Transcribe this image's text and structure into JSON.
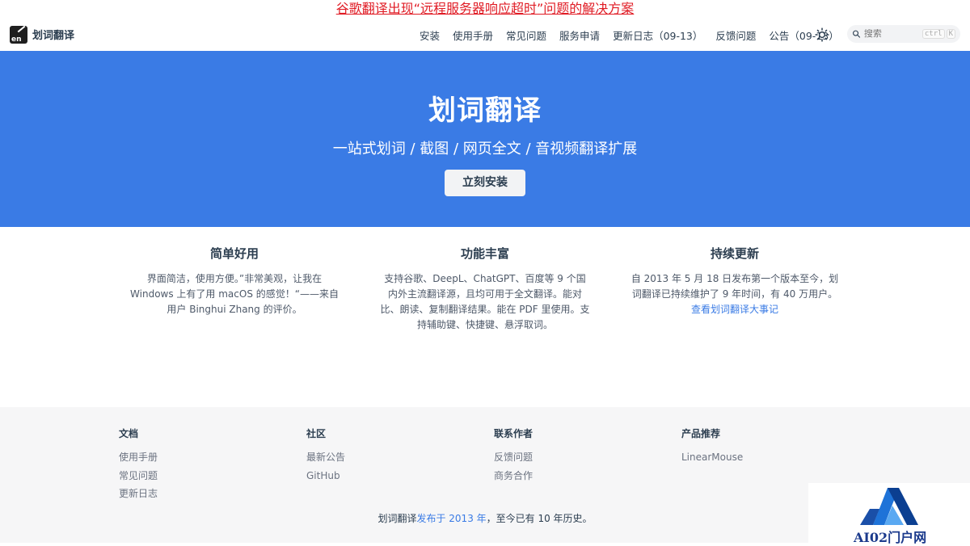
{
  "announcement": "谷歌翻译出现“远程服务器响应超时”问题的解决方案",
  "brand": {
    "name": "划词翻译",
    "logo_text": "en"
  },
  "nav": [
    "安装",
    "使用手册",
    "常见问题",
    "服务申请",
    "更新日志（09-13）",
    "反馈问题",
    "公告（09-13）"
  ],
  "search": {
    "placeholder": "搜索",
    "key1": "ctrl",
    "key2": "K"
  },
  "hero": {
    "title": "划词翻译",
    "tagline": "一站式划词 / 截图 / 网页全文 / 音视频翻译扩展",
    "button": "立刻安装"
  },
  "features": [
    {
      "title": "简单好用",
      "text": "界面简洁，使用方便。”非常美观，让我在 Windows 上有了用 macOS 的感觉！“——来自用户 Binghui Zhang 的评价。"
    },
    {
      "title": "功能丰富",
      "text": "支持谷歌、DeepL、ChatGPT、百度等 9 个国内外主流翻译源，且均可用于全文翻译。能对比、朗读、复制翻译结果。能在 PDF 里使用。支持辅助键、快捷键、悬浮取词。"
    },
    {
      "title": "持续更新",
      "text": "自 2013 年 5 月 18 日发布第一个版本至今，划词翻译已持续维护了 9 年时间，有 40 万用户。",
      "link": "查看划词翻译大事记"
    }
  ],
  "footer": {
    "columns": [
      {
        "title": "文档",
        "links": [
          "使用手册",
          "常见问题",
          "更新日志"
        ]
      },
      {
        "title": "社区",
        "links": [
          "最新公告",
          "GitHub"
        ]
      },
      {
        "title": "联系作者",
        "links": [
          "反馈问题",
          "商务合作"
        ]
      },
      {
        "title": "产品推荐",
        "links": [
          "LinearMouse"
        ]
      }
    ],
    "copyright_prefix": "划词翻译",
    "copyright_link": "发布于 2013 年",
    "copyright_suffix": "，至今已有 10 年历史。"
  },
  "watermark": "AI02门户网",
  "colors": {
    "hero": "#3a7be5",
    "announcement": "#e01b24",
    "link": "#3a7be5"
  }
}
